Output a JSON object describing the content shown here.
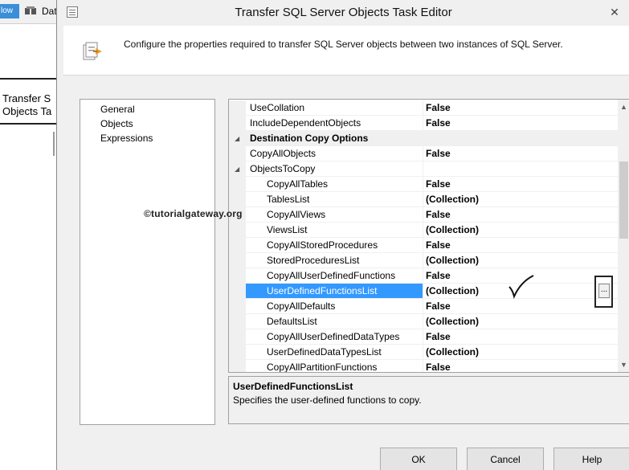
{
  "background_app": {
    "flow_button_label": "low",
    "data_tab_label": "Dat",
    "task_box_line1": "Transfer S",
    "task_box_line2": "Objects Ta"
  },
  "dialog": {
    "title": "Transfer SQL Server Objects Task Editor",
    "close_glyph": "✕",
    "description": "Configure the properties required to transfer SQL Server objects between two instances of SQL Server."
  },
  "nav": {
    "items": [
      {
        "label": "General"
      },
      {
        "label": "Objects"
      },
      {
        "label": "Expressions"
      }
    ],
    "selected": "Objects"
  },
  "properties": {
    "rows": [
      {
        "name": "UseCollation",
        "value": "False",
        "kind": "prop"
      },
      {
        "name": "IncludeDependentObjects",
        "value": "False",
        "kind": "prop"
      },
      {
        "name": "Destination Copy Options",
        "value": "",
        "kind": "category",
        "expanded": true
      },
      {
        "name": "CopyAllObjects",
        "value": "False",
        "kind": "prop"
      },
      {
        "name": "ObjectsToCopy",
        "value": "",
        "kind": "group",
        "expanded": true
      },
      {
        "name": "CopyAllTables",
        "value": "False",
        "kind": "child"
      },
      {
        "name": "TablesList",
        "value": "(Collection)",
        "kind": "child"
      },
      {
        "name": "CopyAllViews",
        "value": "False",
        "kind": "child"
      },
      {
        "name": "ViewsList",
        "value": "(Collection)",
        "kind": "child"
      },
      {
        "name": "CopyAllStoredProcedures",
        "value": "False",
        "kind": "child"
      },
      {
        "name": "StoredProceduresList",
        "value": "(Collection)",
        "kind": "child"
      },
      {
        "name": "CopyAllUserDefinedFunctions",
        "value": "False",
        "kind": "child"
      },
      {
        "name": "UserDefinedFunctionsList",
        "value": "(Collection)",
        "kind": "child",
        "selected": true
      },
      {
        "name": "CopyAllDefaults",
        "value": "False",
        "kind": "child"
      },
      {
        "name": "DefaultsList",
        "value": "(Collection)",
        "kind": "child"
      },
      {
        "name": "CopyAllUserDefinedDataTypes",
        "value": "False",
        "kind": "child"
      },
      {
        "name": "UserDefinedDataTypesList",
        "value": "(Collection)",
        "kind": "child"
      },
      {
        "name": "CopyAllPartitionFunctions",
        "value": "False",
        "kind": "child"
      }
    ],
    "ellipsis_label": "...",
    "watermark": "©tutorialgateway.org",
    "scroll_up_glyph": "▲",
    "scroll_down_glyph": "▼"
  },
  "description_pane": {
    "title": "UserDefinedFunctionsList",
    "text": "Specifies the user-defined functions to copy."
  },
  "buttons": {
    "ok": "OK",
    "cancel": "Cancel",
    "help": "Help"
  },
  "colors": {
    "selection": "#3399ff",
    "dialog_bg": "#f0f0f0"
  }
}
